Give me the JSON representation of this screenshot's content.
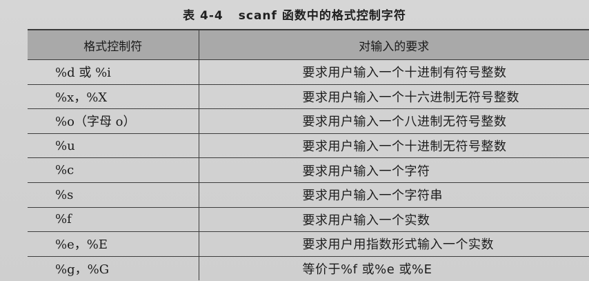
{
  "caption": {
    "number": "表 4-4",
    "title": "scanf 函数中的格式控制字符"
  },
  "table": {
    "headers": [
      "格式控制符",
      "对输入的要求"
    ],
    "rows": [
      [
        "%d 或 %i",
        "要求用户输入一个十进制有符号整数"
      ],
      [
        "%x，%X",
        "要求用户输入一个十六进制无符号整数"
      ],
      [
        "%o（字母 o）",
        "要求用户输入一个八进制无符号整数"
      ],
      [
        "%u",
        "要求用户输入一个十进制无符号整数"
      ],
      [
        "%c",
        "要求用户输入一个字符"
      ],
      [
        "%s",
        "要求用户输入一个字符串"
      ],
      [
        "%f",
        "要求用户输入一个实数"
      ],
      [
        "%e，%E",
        "要求用户用指数形式输入一个实数"
      ],
      [
        "%g，%G",
        "等价于%f 或%e 或%E"
      ]
    ]
  }
}
